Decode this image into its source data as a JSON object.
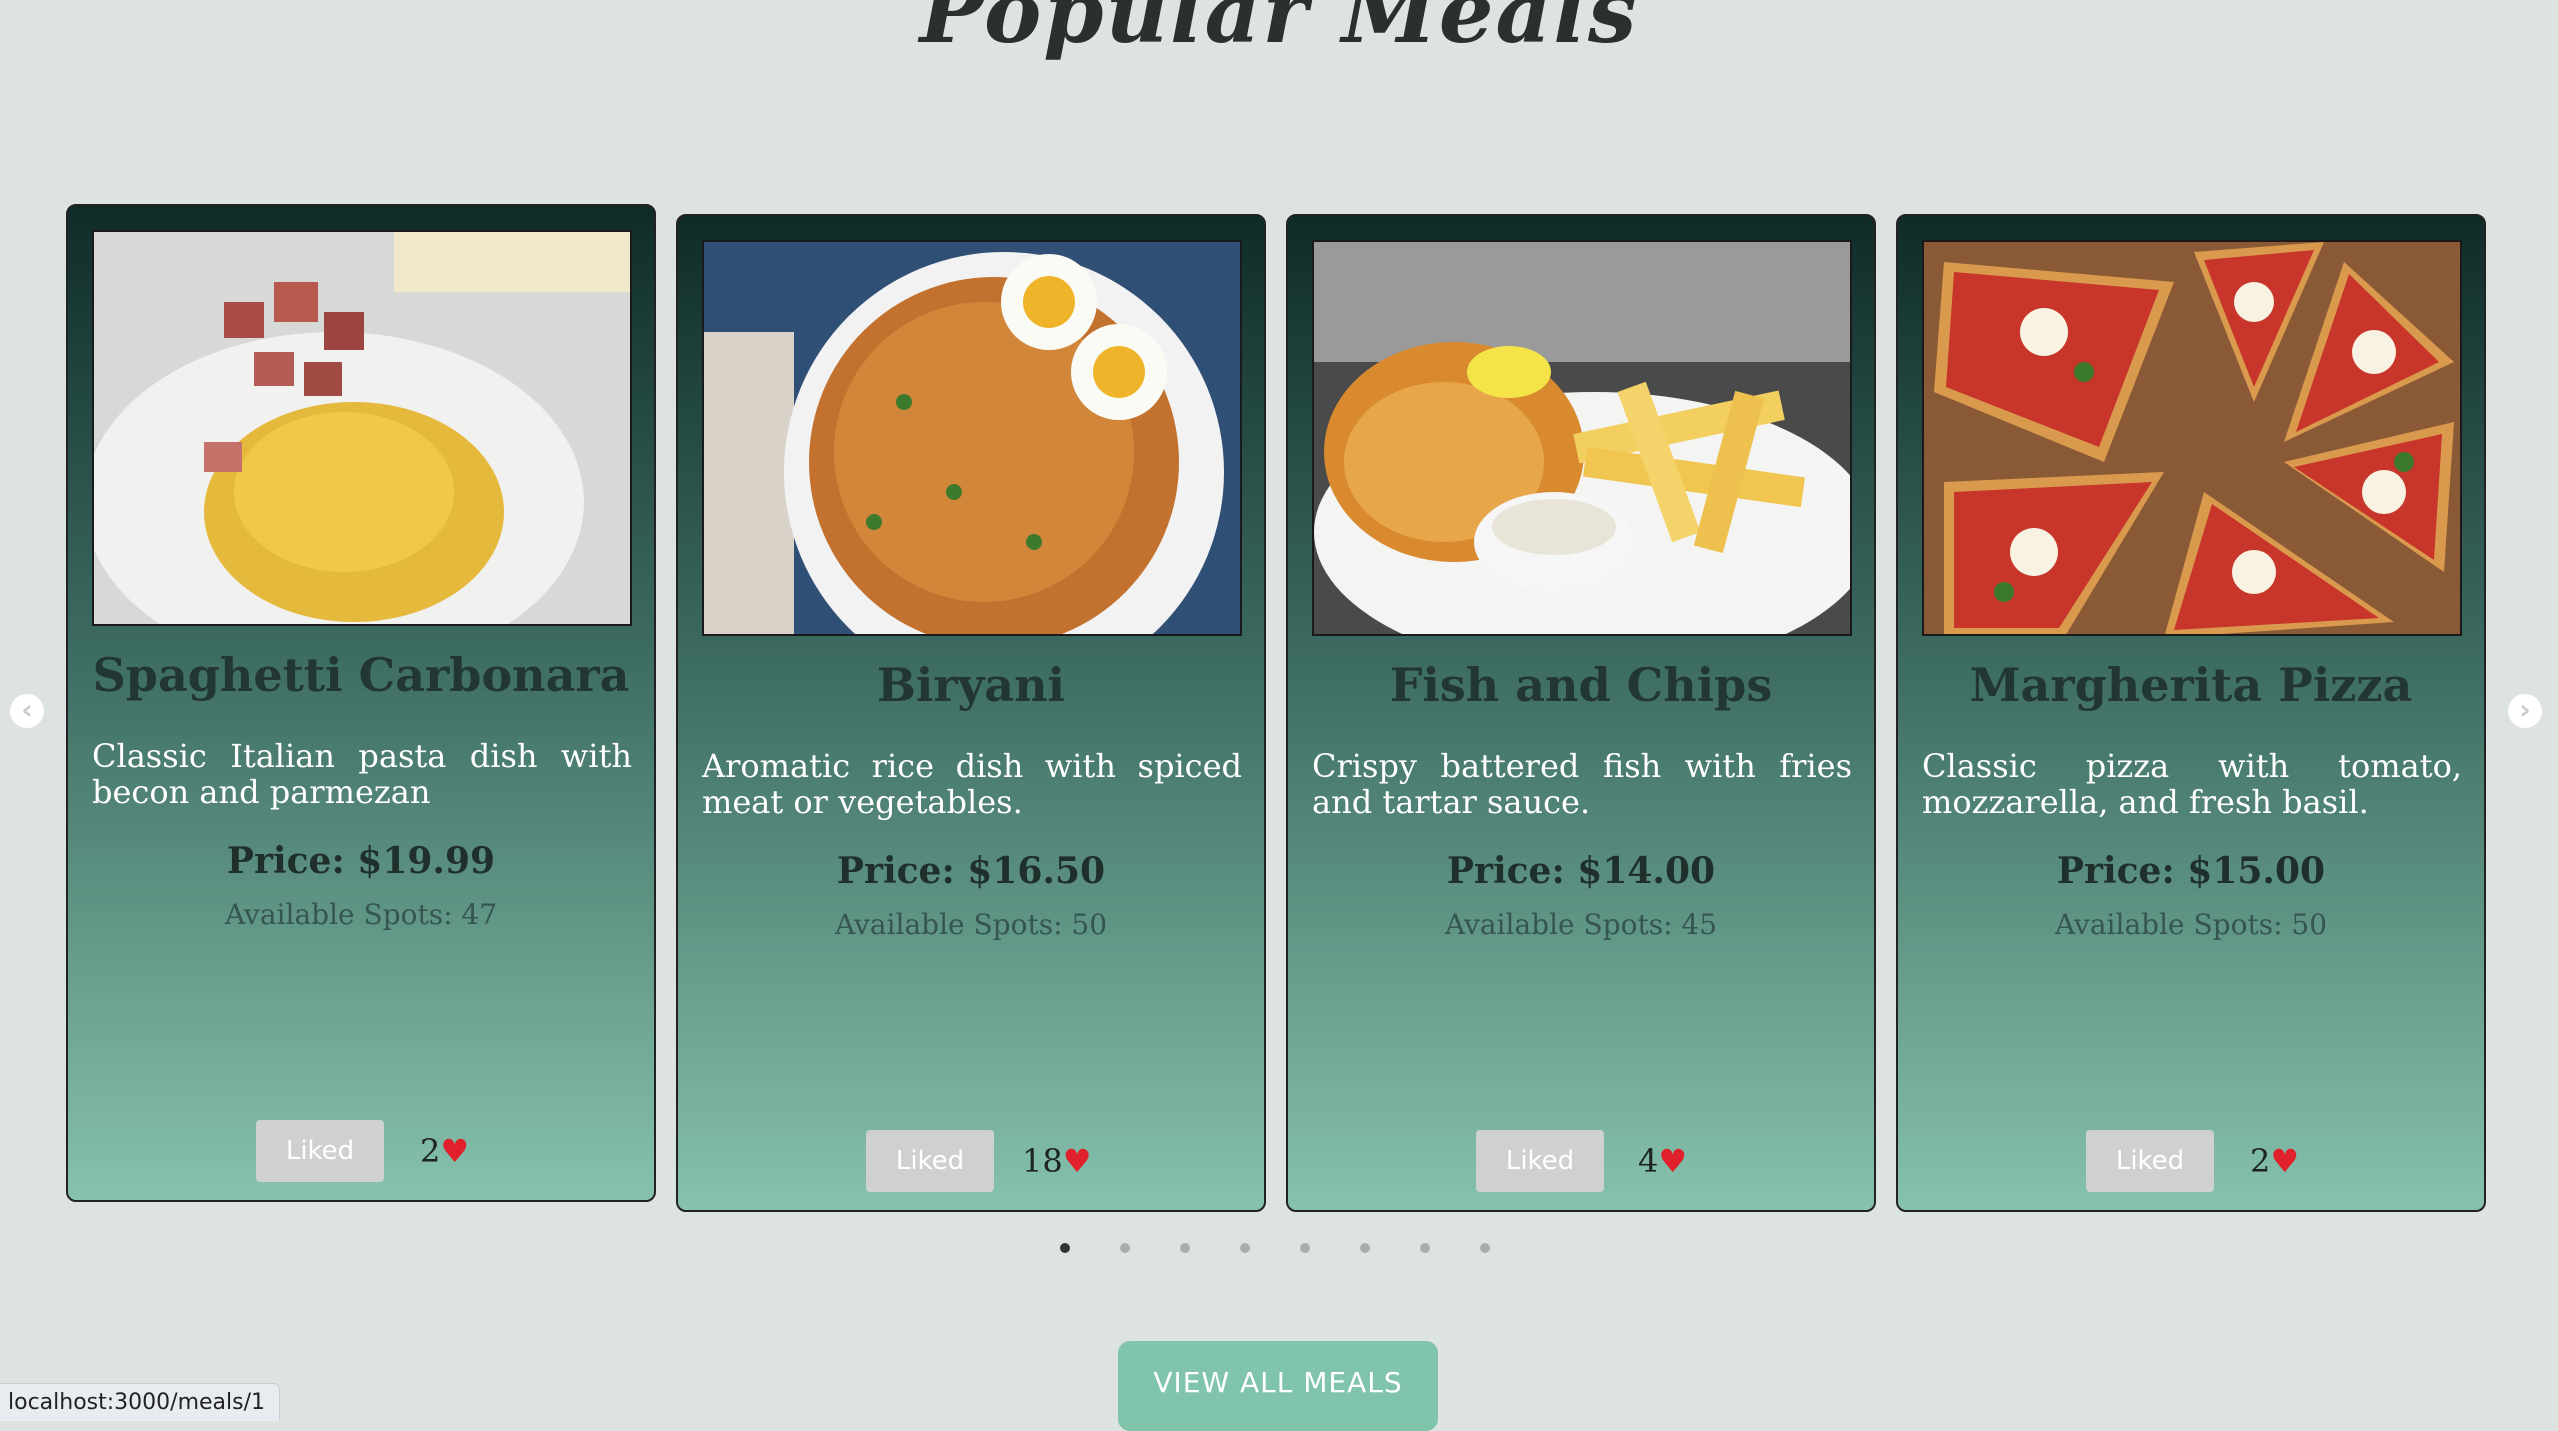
{
  "header": {
    "title": "Popular Meals"
  },
  "carousel": {
    "prev_icon": "chevron-left-icon",
    "next_icon": "chevron-right-icon",
    "dot_count": 8,
    "active_dot": 1
  },
  "meals": [
    {
      "name": "Spaghetti Carbonara",
      "description": "Classic Italian pasta dish with becon and parmezan",
      "price": "Price: $19.99",
      "spots": "Available Spots: 47",
      "like_label": "Liked",
      "likes": "2",
      "image": "spaghetti-carbonara-photo"
    },
    {
      "name": "Biryani",
      "description": "Aromatic rice dish with spiced meat or vegetables.",
      "price": "Price: $16.50",
      "spots": "Available Spots: 50",
      "like_label": "Liked",
      "likes": "18",
      "image": "biryani-photo"
    },
    {
      "name": "Fish and Chips",
      "description": "Crispy battered fish with fries and tartar sauce.",
      "price": "Price: $14.00",
      "spots": "Available Spots: 45",
      "like_label": "Liked",
      "likes": "4",
      "image": "fish-and-chips-photo"
    },
    {
      "name": "Margherita Pizza",
      "description": "Classic pizza with tomato, mozzarella, and fresh basil.",
      "price": "Price: $15.00",
      "spots": "Available Spots: 50",
      "like_label": "Liked",
      "likes": "2",
      "image": "margherita-pizza-photo"
    }
  ],
  "footer": {
    "view_all_label": "VIEW ALL MEALS"
  },
  "status_bar": {
    "url": "localhost:3000/meals/1"
  },
  "colors": {
    "accent": "#7fc4ab",
    "card_dark": "#0f2b28",
    "heart": "#e0202a"
  }
}
